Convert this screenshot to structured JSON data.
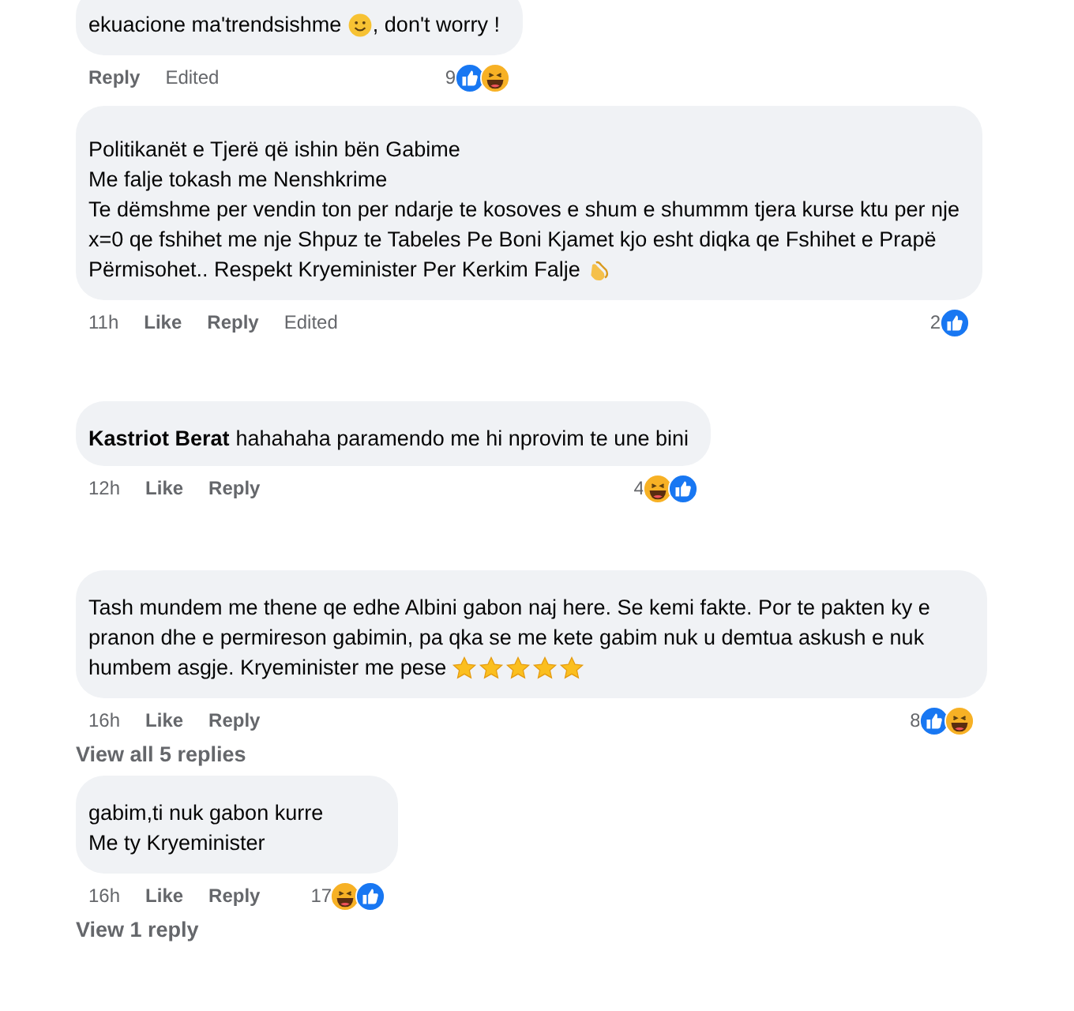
{
  "comments": [
    {
      "lines": [
        [
          {
            "kind": "text",
            "text": "ekuacione ma'trendsishme "
          },
          {
            "kind": "smile"
          },
          {
            "kind": "text",
            "text": ", don't worry !"
          }
        ]
      ],
      "reply": "Reply",
      "edited": "Edited",
      "count": "9",
      "reactions": [
        {
          "kind": "like"
        },
        {
          "kind": "haha"
        }
      ]
    },
    {
      "lines": [
        [
          {
            "kind": "text",
            "text": "Politikanët e Tjerë që ishin bën Gabime"
          }
        ],
        [
          {
            "kind": "text",
            "text": "Me falje tokash me Nenshkrime"
          }
        ],
        [
          {
            "kind": "text",
            "text": "Te dëmshme per vendin ton per ndarje te kosoves e shum e shummm tjera kurse ktu per nje"
          }
        ],
        [
          {
            "kind": "text",
            "text": "x=0 qe fshihet me nje Shpuz te Tabeles Pe Boni Kjamet kjo esht diqka qe Fshihet e Prapë"
          }
        ],
        [
          {
            "kind": "text",
            "text": "Përmisohet.. Respekt Kryeminister Per Kerkim Falje "
          },
          {
            "kind": "clap"
          }
        ]
      ],
      "time": "11h",
      "like": "Like",
      "reply": "Reply",
      "edited": "Edited",
      "count": "2",
      "reactions": [
        {
          "kind": "like"
        }
      ]
    },
    {
      "author": "Kastriot Berat",
      "lines": [
        [
          {
            "kind": "text",
            "text": "hahahaha paramendo me hi nprovim te une bini"
          }
        ]
      ],
      "time": "12h",
      "like": "Like",
      "reply": "Reply",
      "count": "4",
      "reactions": [
        {
          "kind": "haha"
        },
        {
          "kind": "like"
        }
      ]
    },
    {
      "lines": [
        [
          {
            "kind": "text",
            "text": "Tash mundem me thene qe edhe Albini gabon naj here. Se kemi fakte. Por te pakten ky e"
          }
        ],
        [
          {
            "kind": "text",
            "text": "pranon dhe e permireson gabimin, pa qka se me kete gabim nuk u demtua askush e nuk"
          }
        ],
        [
          {
            "kind": "text",
            "text": "humbem asgje. Kryeminister me pese "
          },
          {
            "kind": "star"
          },
          {
            "kind": "star"
          },
          {
            "kind": "star"
          },
          {
            "kind": "star"
          },
          {
            "kind": "star"
          }
        ]
      ],
      "time": "16h",
      "like": "Like",
      "reply": "Reply",
      "count": "8",
      "reactions": [
        {
          "kind": "like"
        },
        {
          "kind": "haha"
        }
      ],
      "replies": "View all 5 replies"
    },
    {
      "lines": [
        [
          {
            "kind": "text",
            "text": "gabim,ti nuk gabon kurre"
          }
        ],
        [
          {
            "kind": "text",
            "text": "Me ty Kryeminister"
          }
        ]
      ],
      "time": "16h",
      "like": "Like",
      "reply": "Reply",
      "count": "17",
      "reactions": [
        {
          "kind": "haha"
        },
        {
          "kind": "like"
        }
      ],
      "replies": "View 1 reply"
    }
  ]
}
